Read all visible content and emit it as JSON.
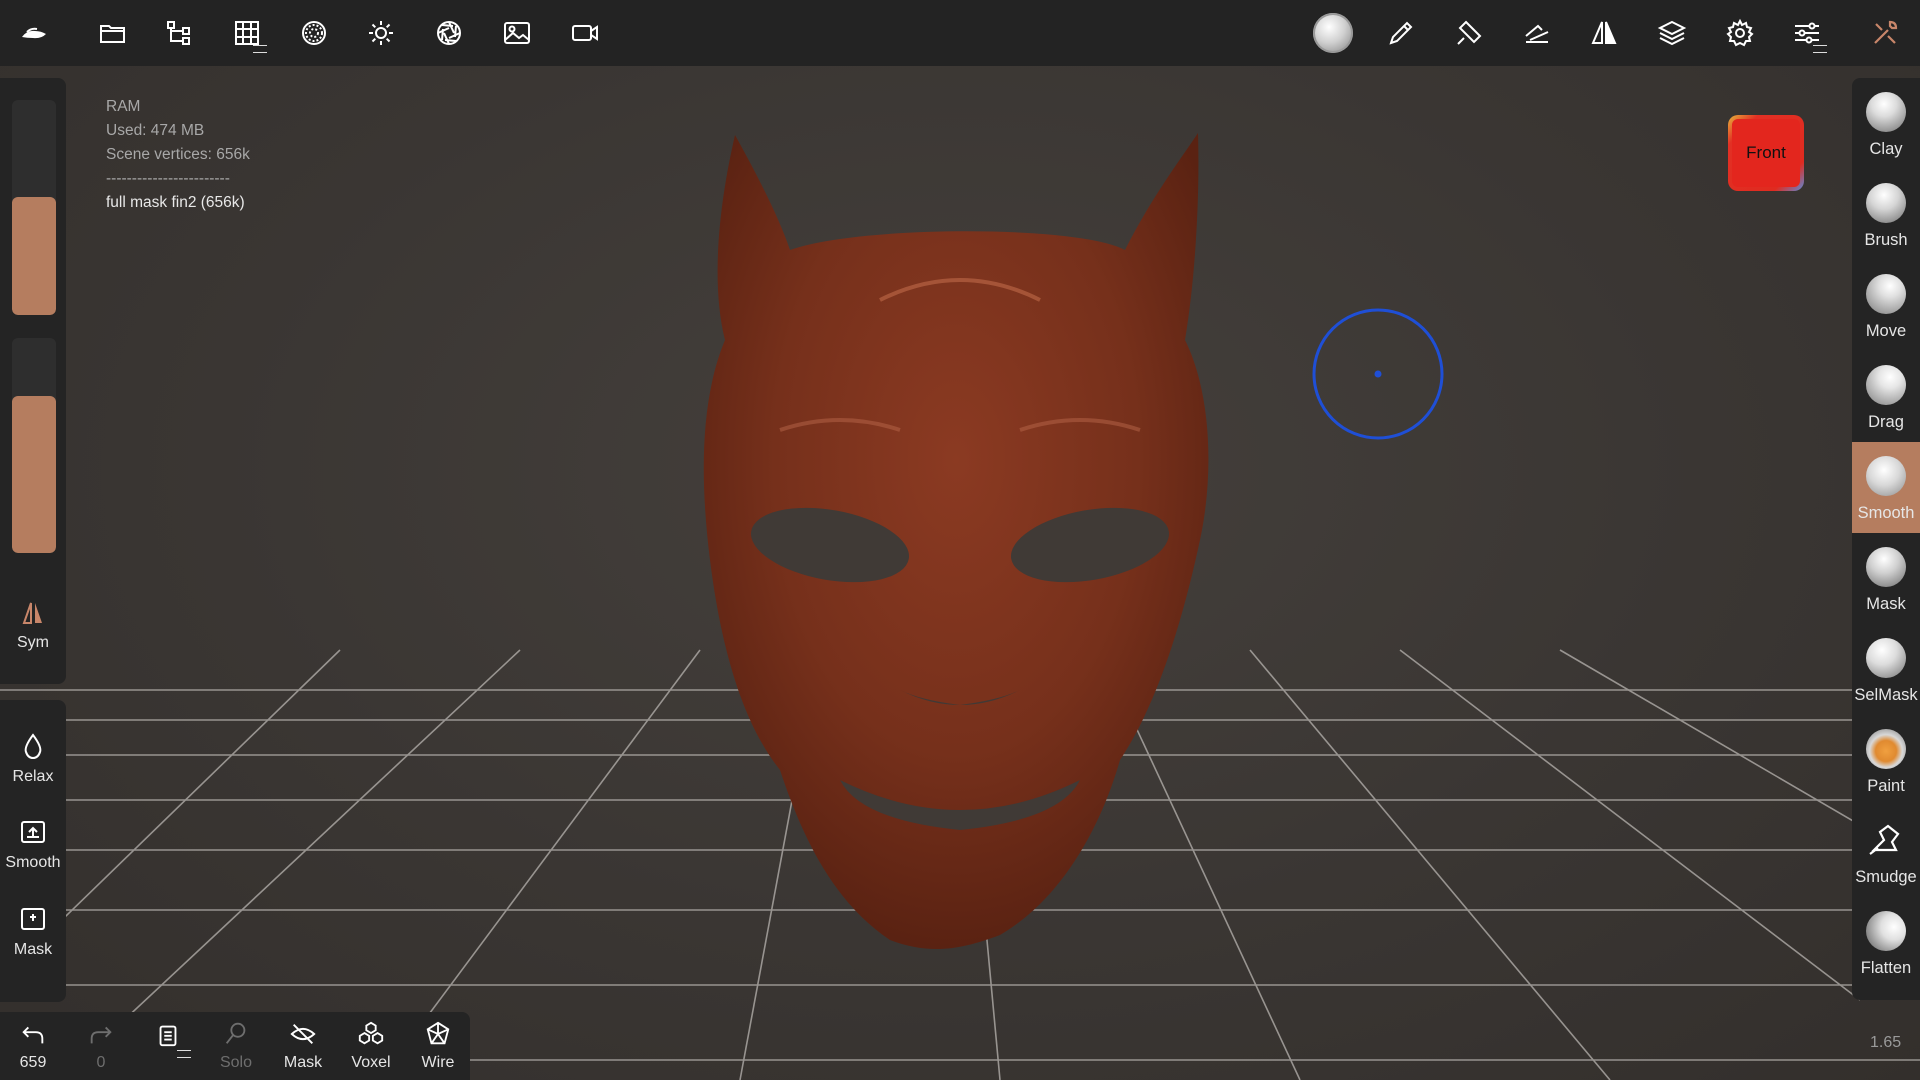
{
  "toolbar": {
    "left_icons": [
      "app-logo-icon",
      "folder-icon",
      "scene-tree-icon",
      "topology-icon",
      "material-sphere-icon",
      "light-icon",
      "aperture-icon",
      "image-icon",
      "video-camera-icon"
    ],
    "right_icons": [
      "current-brush-icon",
      "pen-icon",
      "paint-bucket-icon",
      "stroke-icon",
      "symmetry-icon",
      "layers-icon",
      "settings-icon",
      "sliders-icon",
      "tools-icon"
    ]
  },
  "info": {
    "ram_label": "RAM",
    "used": "Used: 474 MB",
    "vertices": "Scene vertices: 656k",
    "separator": "------------------------",
    "mesh_name": "full mask fin2 (656k)"
  },
  "left_panel": {
    "radius_level": 0.55,
    "intensity_level": 0.73,
    "sym_label": "Sym",
    "tools": [
      {
        "label": "Relax",
        "icon": "droplet-icon"
      },
      {
        "label": "Smooth",
        "icon": "smooth-box-icon"
      },
      {
        "label": "Mask",
        "icon": "mask-box-icon"
      }
    ]
  },
  "brushes": [
    {
      "label": "Clay",
      "selected": false
    },
    {
      "label": "Brush",
      "selected": false
    },
    {
      "label": "Move",
      "selected": false
    },
    {
      "label": "Drag",
      "selected": false
    },
    {
      "label": "Smooth",
      "selected": true
    },
    {
      "label": "Mask",
      "selected": false
    },
    {
      "label": "SelMask",
      "selected": false
    },
    {
      "label": "Paint",
      "selected": false
    },
    {
      "label": "Smudge",
      "selected": false
    },
    {
      "label": "Flatten",
      "selected": false
    }
  ],
  "bottom": {
    "undo_count": "659",
    "redo_count": "0",
    "solo": "Solo",
    "mask": "Mask",
    "voxel": "Voxel",
    "wire": "Wire"
  },
  "view_cube": {
    "label": "Front"
  },
  "zoom": "1.65",
  "colors": {
    "accent": "#b57d5f",
    "mask": "#7a2f1c",
    "cursor": "#1f4fd6",
    "front": "#e3261e"
  }
}
